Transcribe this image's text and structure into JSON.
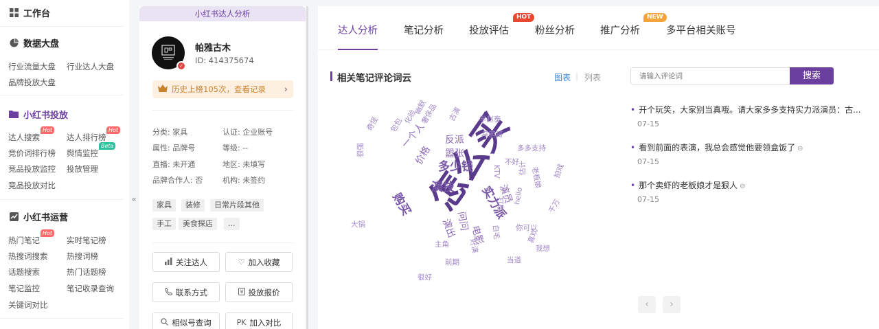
{
  "sidebar": {
    "workbench": "工作台",
    "data_dashboard": {
      "title": "数据大盘",
      "items": [
        "行业流量大盘",
        "行业达人大盘",
        "品牌投放大盘"
      ]
    },
    "xhs_ad": {
      "title": "小红书投放",
      "items": [
        {
          "label": "达人搜索",
          "badge": "Hot"
        },
        {
          "label": "达人排行榜",
          "badge": "Hot"
        },
        {
          "label": "竞价词排行榜",
          "badge": ""
        },
        {
          "label": "舆情监控",
          "badge": "Beta"
        },
        {
          "label": "竞品投放监控",
          "badge": ""
        },
        {
          "label": "投放管理",
          "badge": ""
        },
        {
          "label": "竞品投放对比",
          "badge": ""
        }
      ]
    },
    "xhs_ops": {
      "title": "小红书运营",
      "items": [
        {
          "label": "热门笔记",
          "badge": "Hot"
        },
        {
          "label": "实时笔记榜",
          "badge": ""
        },
        {
          "label": "热搜词搜索",
          "badge": ""
        },
        {
          "label": "热搜词榜",
          "badge": ""
        },
        {
          "label": "话题搜索",
          "badge": ""
        },
        {
          "label": "热门话题榜",
          "badge": ""
        },
        {
          "label": "笔记监控",
          "badge": ""
        },
        {
          "label": "笔记收录查询",
          "badge": ""
        },
        {
          "label": "关键词对比",
          "badge": ""
        }
      ]
    },
    "collapse_glyph": "«"
  },
  "profile": {
    "panel_title": "小红书达人分析",
    "name": "帕雅古木",
    "id_label": "ID:",
    "id_value": "414375674",
    "history": "历史上榜105次，查看记录",
    "attrs": {
      "category": "分类: 家具",
      "certification": "认证: 企业账号",
      "attribute": "属性: 品牌号",
      "level": "等级: --",
      "live": "直播: 未开通",
      "region": "地区: 未填写",
      "partner": "品牌合作人: 否",
      "agency": "机构: 未签约"
    },
    "tags": [
      "家具",
      "装修",
      "日常片段其他",
      "手工",
      "美食探店",
      "..."
    ],
    "buttons": {
      "follow": "关注达人",
      "favorite": "加入收藏",
      "contact": "联系方式",
      "quote": "投放报价",
      "similar": "相似号查询",
      "compare": "加入对比",
      "compare_prefix": "PK"
    }
  },
  "main": {
    "tabs": [
      {
        "label": "达人分析",
        "badge": ""
      },
      {
        "label": "笔记分析",
        "badge": ""
      },
      {
        "label": "投放评估",
        "badge": "HOT"
      },
      {
        "label": "粉丝分析",
        "badge": ""
      },
      {
        "label": "推广分析",
        "badge": "NEW"
      },
      {
        "label": "多平台相关账号",
        "badge": ""
      }
    ],
    "section_title": "相关笔记评论词云",
    "view_chart": "图表",
    "view_divider": "|",
    "view_list": "列表",
    "search_placeholder": "请输入评论词",
    "search_button": "搜索",
    "comments": [
      {
        "text": "开个玩笑，大家别当真哦。请大家多多支持实力派演员：古...",
        "date": "07-15",
        "has_link": false
      },
      {
        "text": "看到前面的表演，我总会感觉他要领盒饭了",
        "date": "07-15",
        "has_link": true
      },
      {
        "text": "那个卖虾的老板娘才是狠人",
        "date": "07-15",
        "has_link": true
      }
    ],
    "pager_prev": "‹",
    "pager_next": "›",
    "word_cloud": [
      {
        "w": "怎么买",
        "size": 5
      },
      {
        "w": "演技",
        "size": 3
      },
      {
        "w": "多少钱",
        "size": 3
      },
      {
        "w": "实力派",
        "size": 3
      },
      {
        "w": "购买",
        "size": 3
      },
      {
        "w": "演员",
        "size": 2
      },
      {
        "w": "问问",
        "size": 2
      },
      {
        "w": "演出",
        "size": 2
      },
      {
        "w": "价格",
        "size": 2
      },
      {
        "w": "嚣张",
        "size": 2
      },
      {
        "w": "反派",
        "size": 2
      },
      {
        "w": "一个人",
        "size": 2
      },
      {
        "w": "电影",
        "size": 2
      },
      {
        "w": "好演",
        "size": 1
      },
      {
        "w": "白毛",
        "size": 1
      },
      {
        "w": "乌鸦哥",
        "size": 1
      },
      {
        "w": "不好",
        "size": 1
      },
      {
        "w": "打斯",
        "size": 1
      },
      {
        "w": "估计",
        "size": 1
      },
      {
        "w": "多多支持",
        "size": 1
      },
      {
        "w": "学赵泰",
        "size": 1
      },
      {
        "w": "古演",
        "size": 1
      },
      {
        "w": "奢侈品",
        "size": 1
      },
      {
        "w": "化验",
        "size": 1
      },
      {
        "w": "包包",
        "size": 1
      },
      {
        "w": "幽默",
        "size": 1
      },
      {
        "w": "奇怪",
        "size": 1
      },
      {
        "w": "很强",
        "size": 1
      },
      {
        "w": "主角",
        "size": 1
      },
      {
        "w": "前期",
        "size": 1
      },
      {
        "w": "大锅",
        "size": 1
      },
      {
        "w": "你可以",
        "size": 1
      },
      {
        "w": "当道",
        "size": 1
      },
      {
        "w": "很好",
        "size": 1
      },
      {
        "w": "hello",
        "size": 1
      },
      {
        "w": "KTV",
        "size": 1
      },
      {
        "w": "拍戏",
        "size": 1
      },
      {
        "w": "老板娘",
        "size": 1
      },
      {
        "w": "千万",
        "size": 1
      },
      {
        "w": "喜欢",
        "size": 1
      },
      {
        "w": "我想",
        "size": 1
      }
    ]
  }
}
